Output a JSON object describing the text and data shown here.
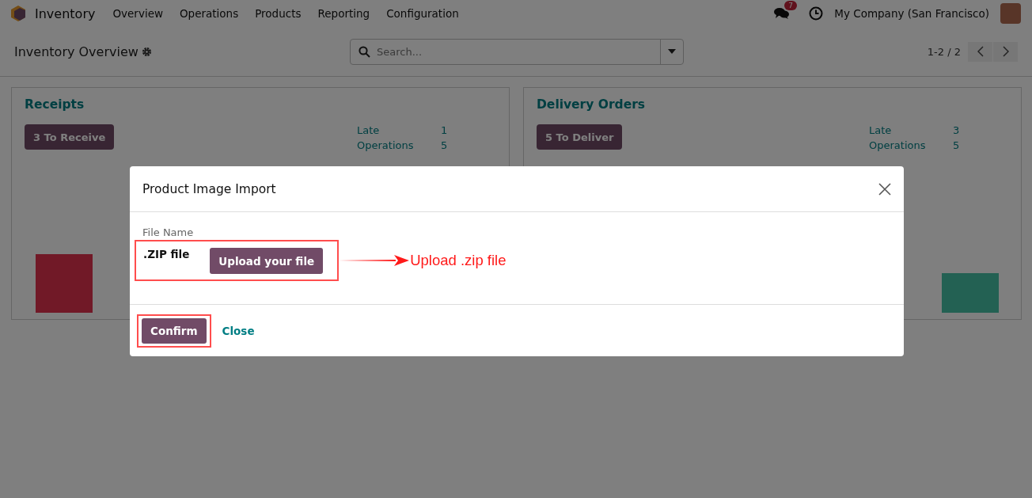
{
  "navbar": {
    "app": "Inventory",
    "menu": [
      "Overview",
      "Operations",
      "Products",
      "Reporting",
      "Configuration"
    ],
    "messages_badge": "7",
    "company": "My Company (San Francisco)"
  },
  "control_panel": {
    "title": "Inventory Overview",
    "search": {
      "placeholder": "Search..."
    },
    "pager": "1-2 / 2"
  },
  "cards": [
    {
      "title": "Receipts",
      "button": "3 To Receive",
      "stats": [
        {
          "label": "Late",
          "value": "1"
        },
        {
          "label": "Operations",
          "value": "5"
        }
      ]
    },
    {
      "title": "Delivery Orders",
      "button": "5 To Deliver",
      "stats": [
        {
          "label": "Late",
          "value": "3"
        },
        {
          "label": "Operations",
          "value": "5"
        }
      ]
    }
  ],
  "dialog": {
    "title": "Product Image Import",
    "field_label": "File Name",
    "field_value": ".ZIP file",
    "upload_button": "Upload your file",
    "buttons": [
      {
        "label": "Confirm",
        "kind": "primary"
      },
      {
        "label": "Close",
        "kind": "link"
      }
    ]
  },
  "annotation": {
    "text": "Upload .zip file"
  }
}
